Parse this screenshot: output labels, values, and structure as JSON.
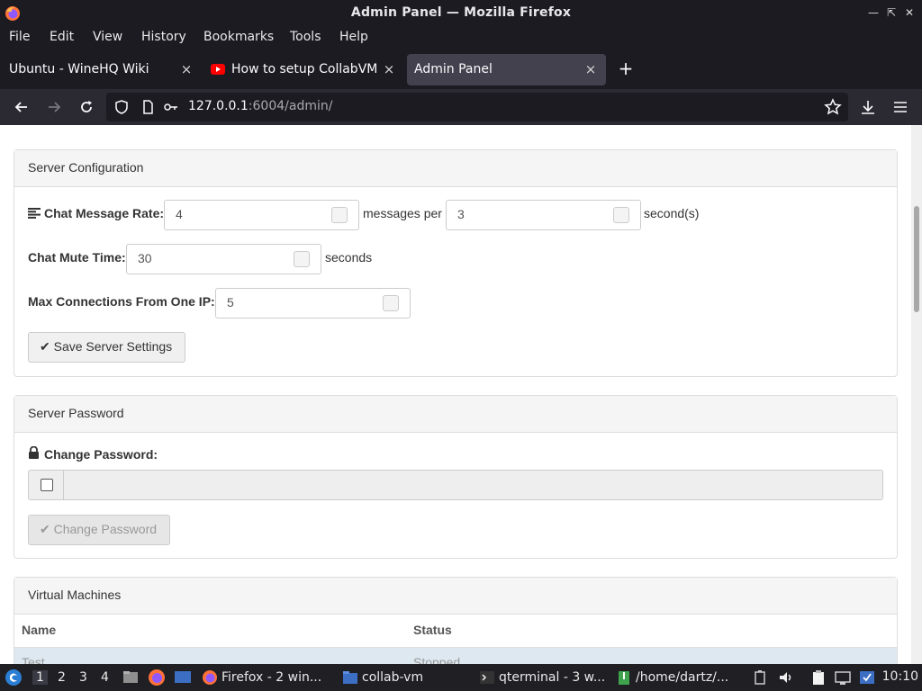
{
  "window": {
    "title": "Admin Panel — Mozilla Firefox",
    "controls": [
      "minimize",
      "maximize",
      "close"
    ]
  },
  "menu": [
    "File",
    "Edit",
    "View",
    "History",
    "Bookmarks",
    "Tools",
    "Help"
  ],
  "tabs": [
    {
      "label": "Ubuntu - WineHQ Wiki",
      "active": false
    },
    {
      "label": "How to setup CollabVM S",
      "active": false
    },
    {
      "label": "Admin Panel",
      "active": true
    }
  ],
  "address": {
    "host": "127.0.0.1",
    "rest": ":6004/admin/"
  },
  "server_config": {
    "heading": "Server Configuration",
    "chat_rate_label": "Chat Message Rate:",
    "chat_rate_value": "4",
    "messages_per": "messages per",
    "seconds_value": "3",
    "seconds_suffix": "second(s)",
    "mute_label": "Chat Mute Time:",
    "mute_value": "30",
    "mute_suffix": "seconds",
    "maxconn_label": "Max Connections From One IP:",
    "maxconn_value": "5",
    "save_button": "Save Server Settings"
  },
  "server_password": {
    "heading": "Server Password",
    "change_label": "Change Password:",
    "change_button": "Change Password",
    "checkbox_checked": false
  },
  "vms": {
    "heading": "Virtual Machines",
    "columns": [
      "Name",
      "Status"
    ],
    "rows": [
      {
        "name": "Test",
        "status": "Stopped"
      }
    ]
  },
  "taskbar": {
    "workspaces": [
      "1",
      "2",
      "3",
      "4"
    ],
    "active_workspace": "1",
    "tasks": [
      {
        "label": "Firefox - 2 win..."
      },
      {
        "label": "collab-vm"
      },
      {
        "label": "qterminal - 3 w..."
      },
      {
        "label": "/home/dartz/..."
      }
    ],
    "clock": "10:10"
  }
}
